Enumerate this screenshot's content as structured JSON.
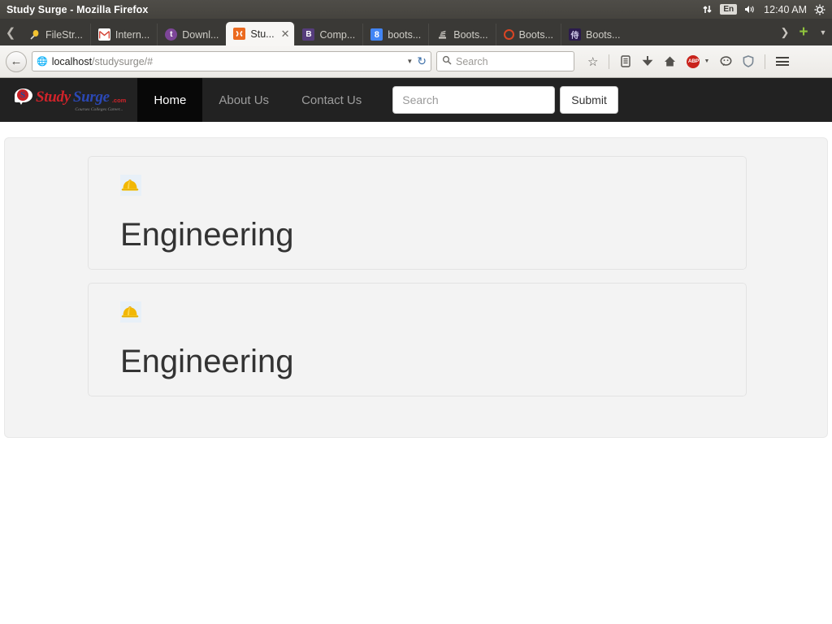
{
  "window": {
    "title": "Study Surge - Mozilla Firefox",
    "tray": {
      "network_icon": "network-arrows-icon",
      "keyboard_layout": "En",
      "volume_icon": "volume-icon",
      "clock": "12:40 AM",
      "gear_icon": "gear-icon"
    }
  },
  "browser": {
    "scroll_left_icon": "chevron-left-icon",
    "tabs": [
      {
        "label": "FileStr...",
        "favicon": "filestr-icon",
        "glyph": "🔦",
        "active": false
      },
      {
        "label": "Intern...",
        "favicon": "gmail-icon",
        "glyph": "M",
        "active": false
      },
      {
        "label": "Downl...",
        "favicon": "tor-icon",
        "glyph": "t",
        "active": false
      },
      {
        "label": "Stu...",
        "favicon": "xampp-icon",
        "glyph": "✶",
        "active": true,
        "close_icon": "close-icon"
      },
      {
        "label": "Comp...",
        "favicon": "bootstrap-b-icon",
        "glyph": "B",
        "active": false
      },
      {
        "label": "boots...",
        "favicon": "google-8-icon",
        "glyph": "8",
        "active": false
      },
      {
        "label": "Boots...",
        "favicon": "stackoverflow-icon",
        "glyph": "☰",
        "active": false
      },
      {
        "label": "Boots...",
        "favicon": "ring-icon",
        "glyph": "",
        "active": false
      },
      {
        "label": "Boots...",
        "favicon": "japanese-icon",
        "glyph": "侍",
        "active": false
      }
    ],
    "tab_overflow_icon": "chevron-right-icon",
    "new_tab_icon": "plus-icon",
    "list_all_tabs_icon": "chevron-down-icon",
    "back_icon": "back-arrow-icon",
    "url": {
      "host": "localhost",
      "path": "/studysurge/#",
      "globe_icon": "globe-icon",
      "dropdown_icon": "chevron-down-icon",
      "reload_icon": "reload-icon"
    },
    "search": {
      "placeholder": "Search",
      "icon": "search-icon"
    },
    "toolbar_icons": [
      {
        "name": "bookmark-star-icon",
        "glyph": "☆"
      },
      {
        "name": "reader-list-icon",
        "glyph": "☰"
      },
      {
        "name": "download-icon",
        "glyph": "⬇"
      },
      {
        "name": "home-icon",
        "glyph": "⌂"
      },
      {
        "name": "adblock-plus-icon",
        "glyph": "ABP"
      },
      {
        "name": "adblock-dropdown-icon",
        "glyph": "▾"
      },
      {
        "name": "chat-icon",
        "glyph": "☺"
      },
      {
        "name": "shield-icon",
        "glyph": "⛨"
      },
      {
        "name": "menu-hamburger-icon",
        "glyph": "☰"
      }
    ]
  },
  "site": {
    "brand": {
      "logo_icon": "speech-bubble-s-icon",
      "logo_letter": "S",
      "name_part1": "Study",
      "name_part2": "Surge",
      "tld": ".com",
      "tagline": "Courses Colleges Career..."
    },
    "nav_links": [
      {
        "label": "Home",
        "active": true
      },
      {
        "label": "About Us",
        "active": false
      },
      {
        "label": "Contact Us",
        "active": false
      }
    ],
    "search_form": {
      "placeholder": "Search",
      "value": "",
      "submit_label": "Submit"
    },
    "cards": [
      {
        "icon": "hard-hat-icon",
        "emoji": "⛑",
        "title": "Engineering"
      },
      {
        "icon": "hard-hat-icon",
        "emoji": "⛑",
        "title": "Engineering"
      }
    ]
  },
  "colors": {
    "titlebar": "#4a4843",
    "tabstrip": "#3a3936",
    "navbar": "#222222",
    "navbar_active": "#080808",
    "panel": "#f3f3f3",
    "heading": "#333333",
    "brand_red": "#d2232a",
    "brand_blue": "#2b48b5"
  }
}
